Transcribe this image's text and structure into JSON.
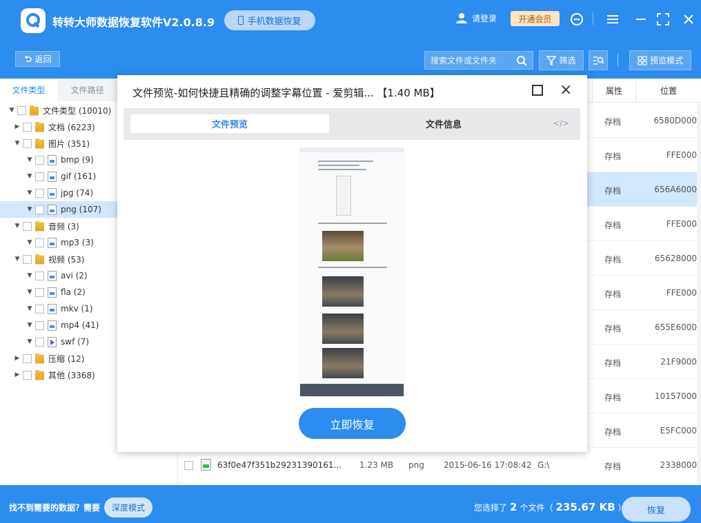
{
  "app": {
    "title": "转转大师数据恢复软件V2.0.8.9",
    "mobile_btn": "手机数据恢复",
    "login": "请登录",
    "vip": "开通会员",
    "brand_color": "#2d8cf0"
  },
  "toolbar": {
    "back": "返回",
    "search_placeholder": "搜索文件或文件夹",
    "filter": "筛选",
    "preview_mode": "预览模式"
  },
  "sidebar": {
    "tabs": [
      "文件类型",
      "文件路径"
    ],
    "tree": [
      {
        "label": "文件类型 (10010)",
        "level": 0,
        "expanded": true,
        "icon": "folder"
      },
      {
        "label": "文档 (6223)",
        "level": 1,
        "expanded": false,
        "icon": "folder"
      },
      {
        "label": "图片 (351)",
        "level": 1,
        "expanded": true,
        "icon": "folder"
      },
      {
        "label": "bmp (9)",
        "level": 2,
        "expanded": true,
        "icon": "file"
      },
      {
        "label": "gif (161)",
        "level": 2,
        "expanded": true,
        "icon": "file"
      },
      {
        "label": "jpg (74)",
        "level": 2,
        "expanded": true,
        "icon": "file"
      },
      {
        "label": "png (107)",
        "level": 2,
        "expanded": true,
        "icon": "file",
        "selected": true
      },
      {
        "label": "音频 (3)",
        "level": 1,
        "expanded": true,
        "icon": "folder"
      },
      {
        "label": "mp3 (3)",
        "level": 2,
        "expanded": true,
        "icon": "file"
      },
      {
        "label": "视频 (53)",
        "level": 1,
        "expanded": true,
        "icon": "folder"
      },
      {
        "label": "avi (2)",
        "level": 2,
        "expanded": true,
        "icon": "file"
      },
      {
        "label": "fla (2)",
        "level": 2,
        "expanded": true,
        "icon": "file"
      },
      {
        "label": "mkv (1)",
        "level": 2,
        "expanded": true,
        "icon": "file"
      },
      {
        "label": "mp4 (41)",
        "level": 2,
        "expanded": true,
        "icon": "file"
      },
      {
        "label": "swf (7)",
        "level": 2,
        "expanded": true,
        "icon": "play"
      },
      {
        "label": "压缩 (12)",
        "level": 1,
        "expanded": false,
        "icon": "folder"
      },
      {
        "label": "其他 (3368)",
        "level": 1,
        "expanded": false,
        "icon": "folder"
      }
    ]
  },
  "table": {
    "headers": {
      "attr": "属性",
      "position": "位置"
    },
    "rows": [
      {
        "attr": "存档",
        "position": "6580D000"
      },
      {
        "attr": "存档",
        "position": "FFE000"
      },
      {
        "attr": "存档",
        "position": "656A6000",
        "selected": true
      },
      {
        "attr": "存档",
        "position": "FFE000"
      },
      {
        "attr": "存档",
        "position": "65628000"
      },
      {
        "attr": "存档",
        "position": "FFE000"
      },
      {
        "attr": "存档",
        "position": "655E6000"
      },
      {
        "attr": "存档",
        "position": "21F9000"
      },
      {
        "attr": "存档",
        "position": "10157000"
      },
      {
        "attr": "存档",
        "position": "E5FC000"
      },
      {
        "attr": "存档",
        "position": "2338000",
        "name": "63f0e47f351b29231390161...",
        "size": "1.23 MB",
        "type": "png",
        "date": "2015-06-16 17:08:42",
        "path": "G:\\"
      }
    ]
  },
  "bottom": {
    "help_text": "找不到需要的数据？需要",
    "deep_mode": "深度模式",
    "selected_prefix": "您选择了",
    "selected_count": "2",
    "selected_mid": "个文件（",
    "selected_size": "235.67 KB",
    "selected_suffix": "）",
    "recover": "恢复"
  },
  "modal": {
    "title": "文件预览-如何快捷且精确的调整字幕位置 - 爱剪辑... 【1.40 MB】",
    "tab_preview": "文件预览",
    "tab_info": "文件信息",
    "code_icon": "</>",
    "restore": "立即恢复"
  }
}
